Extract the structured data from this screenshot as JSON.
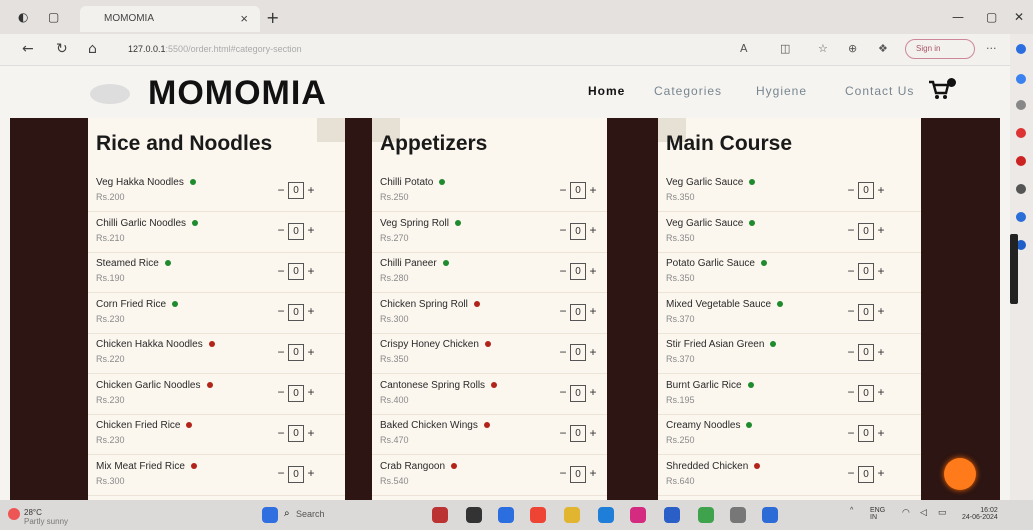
{
  "browser": {
    "tab_title": "MOMOMIA",
    "close_tab": "×",
    "new_tab": "+",
    "url": "127.0.0.1",
    "url_path": ":5500/order.html#category-section",
    "signin": "Sign in",
    "more": "···"
  },
  "site": {
    "brand": "MOMOMIA",
    "nav": [
      "Home",
      "Categories",
      "Hygiene",
      "Contact Us"
    ]
  },
  "menu": {
    "columns": [
      {
        "title": "Rice and Noodles",
        "items": [
          {
            "name": "Veg Hakka Noodles",
            "price": "Rs.200",
            "veg": true,
            "qty": "0"
          },
          {
            "name": "Chilli Garlic Noodles",
            "price": "Rs.210",
            "veg": true,
            "qty": "0"
          },
          {
            "name": "Steamed Rice",
            "price": "Rs.190",
            "veg": true,
            "qty": "0"
          },
          {
            "name": "Corn Fried Rice",
            "price": "Rs.230",
            "veg": true,
            "qty": "0"
          },
          {
            "name": "Chicken Hakka Noodles",
            "price": "Rs.220",
            "veg": false,
            "qty": "0"
          },
          {
            "name": "Chicken Garlic Noodles",
            "price": "Rs.230",
            "veg": false,
            "qty": "0"
          },
          {
            "name": "Chicken Fried Rice",
            "price": "Rs.230",
            "veg": false,
            "qty": "0"
          },
          {
            "name": "Mix Meat Fried Rice",
            "price": "Rs.300",
            "veg": false,
            "qty": "0"
          }
        ]
      },
      {
        "title": "Appetizers",
        "items": [
          {
            "name": "Chilli Potato",
            "price": "Rs.250",
            "veg": true,
            "qty": "0"
          },
          {
            "name": "Veg Spring Roll",
            "price": "Rs.270",
            "veg": true,
            "qty": "0"
          },
          {
            "name": "Chilli Paneer",
            "price": "Rs.280",
            "veg": true,
            "qty": "0"
          },
          {
            "name": "Chicken Spring Roll",
            "price": "Rs.300",
            "veg": false,
            "qty": "0"
          },
          {
            "name": "Crispy Honey Chicken",
            "price": "Rs.350",
            "veg": false,
            "qty": "0"
          },
          {
            "name": "Cantonese Spring Rolls",
            "price": "Rs.400",
            "veg": false,
            "qty": "0"
          },
          {
            "name": "Baked Chicken Wings",
            "price": "Rs.470",
            "veg": false,
            "qty": "0"
          },
          {
            "name": "Crab Rangoon",
            "price": "Rs.540",
            "veg": false,
            "qty": "0"
          }
        ]
      },
      {
        "title": "Main Course",
        "items": [
          {
            "name": "Veg Garlic Sauce",
            "price": "Rs.350",
            "veg": true,
            "qty": "0"
          },
          {
            "name": "Veg Garlic Sauce",
            "price": "Rs.350",
            "veg": true,
            "qty": "0"
          },
          {
            "name": "Potato Garlic Sauce",
            "price": "Rs.350",
            "veg": true,
            "qty": "0"
          },
          {
            "name": "Mixed Vegetable Sauce",
            "price": "Rs.370",
            "veg": true,
            "qty": "0"
          },
          {
            "name": "Stir Fried Asian Green",
            "price": "Rs.370",
            "veg": true,
            "qty": "0"
          },
          {
            "name": "Burnt Garlic Rice",
            "price": "Rs.195",
            "veg": true,
            "qty": "0"
          },
          {
            "name": "Creamy Noodles",
            "price": "Rs.250",
            "veg": true,
            "qty": "0"
          },
          {
            "name": "Shredded Chicken",
            "price": "Rs.640",
            "veg": false,
            "qty": "0"
          }
        ]
      }
    ],
    "minus_label": "−",
    "plus_label": "+"
  },
  "taskbar": {
    "weather_temp": "28°C",
    "weather_desc": "Partly sunny",
    "search": "Search",
    "lang": "ENG",
    "lang_sub": "IN",
    "time": "16:02",
    "date": "24-06-2024"
  },
  "colors": {
    "veg": "#1f8a2e",
    "nonveg": "#b2241a",
    "band": "#2c1512",
    "fab": "#ff7a1a"
  }
}
